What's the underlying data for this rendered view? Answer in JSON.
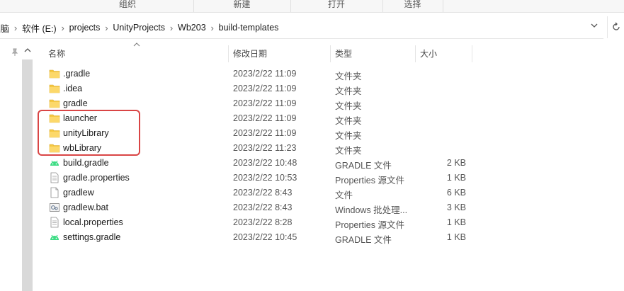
{
  "ribbon": {
    "groups": [
      "组织",
      "新建",
      "打开",
      "选择"
    ]
  },
  "address_bar": {
    "crumbs": [
      "电脑",
      "软件 (E:)",
      "projects",
      "UnityProjects",
      "Wb203",
      "build-templates"
    ]
  },
  "columns": {
    "name": "名称",
    "date": "修改日期",
    "type": "类型",
    "size": "大小"
  },
  "files": [
    {
      "name": ".gradle",
      "date": "2023/2/22 11:09",
      "type": "文件夹",
      "size": "",
      "icon": "folder-icon"
    },
    {
      "name": ".idea",
      "date": "2023/2/22 11:09",
      "type": "文件夹",
      "size": "",
      "icon": "folder-icon"
    },
    {
      "name": "gradle",
      "date": "2023/2/22 11:09",
      "type": "文件夹",
      "size": "",
      "icon": "folder-icon"
    },
    {
      "name": "launcher",
      "date": "2023/2/22 11:09",
      "type": "文件夹",
      "size": "",
      "icon": "folder-icon"
    },
    {
      "name": "unityLibrary",
      "date": "2023/2/22 11:09",
      "type": "文件夹",
      "size": "",
      "icon": "folder-icon"
    },
    {
      "name": "wbLibrary",
      "date": "2023/2/22 11:23",
      "type": "文件夹",
      "size": "",
      "icon": "folder-icon"
    },
    {
      "name": "build.gradle",
      "date": "2023/2/22 10:48",
      "type": "GRADLE 文件",
      "size": "2 KB",
      "icon": "android-icon"
    },
    {
      "name": "gradle.properties",
      "date": "2023/2/22 10:53",
      "type": "Properties 源文件",
      "size": "1 KB",
      "icon": "document-icon"
    },
    {
      "name": "gradlew",
      "date": "2023/2/22 8:43",
      "type": "文件",
      "size": "6 KB",
      "icon": "blank-file-icon"
    },
    {
      "name": "gradlew.bat",
      "date": "2023/2/22 8:43",
      "type": "Windows 批处理...",
      "size": "3 KB",
      "icon": "batch-file-icon"
    },
    {
      "name": "local.properties",
      "date": "2023/2/22 8:28",
      "type": "Properties 源文件",
      "size": "1 KB",
      "icon": "document-icon"
    },
    {
      "name": "settings.gradle",
      "date": "2023/2/22 10:45",
      "type": "GRADLE 文件",
      "size": "1 KB",
      "icon": "android-icon"
    }
  ],
  "colors": {
    "folder": "#f5c842",
    "android": "#3ddc84",
    "highlight_border": "#d94545"
  }
}
